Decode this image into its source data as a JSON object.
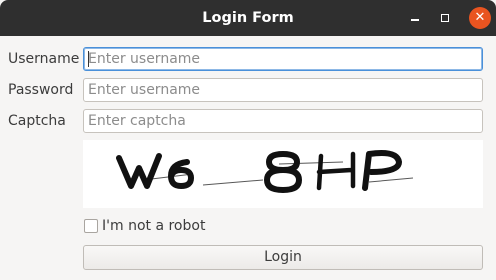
{
  "window": {
    "title": "Login Form",
    "controls": {
      "minimize_icon": "minimize-icon",
      "maximize_icon": "maximize-icon",
      "close_icon": "close-icon",
      "close_color": "#e95420"
    }
  },
  "form": {
    "username": {
      "label": "Username",
      "value": "",
      "placeholder": "Enter username"
    },
    "password": {
      "label": "Password",
      "value": "",
      "placeholder": "Enter username"
    },
    "captcha": {
      "label": "Captcha",
      "value": "",
      "placeholder": "Enter captcha",
      "image_text": "W6 8HP"
    },
    "robot_check": {
      "label": "I'm not a robot",
      "checked": false
    },
    "login_label": "Login"
  }
}
